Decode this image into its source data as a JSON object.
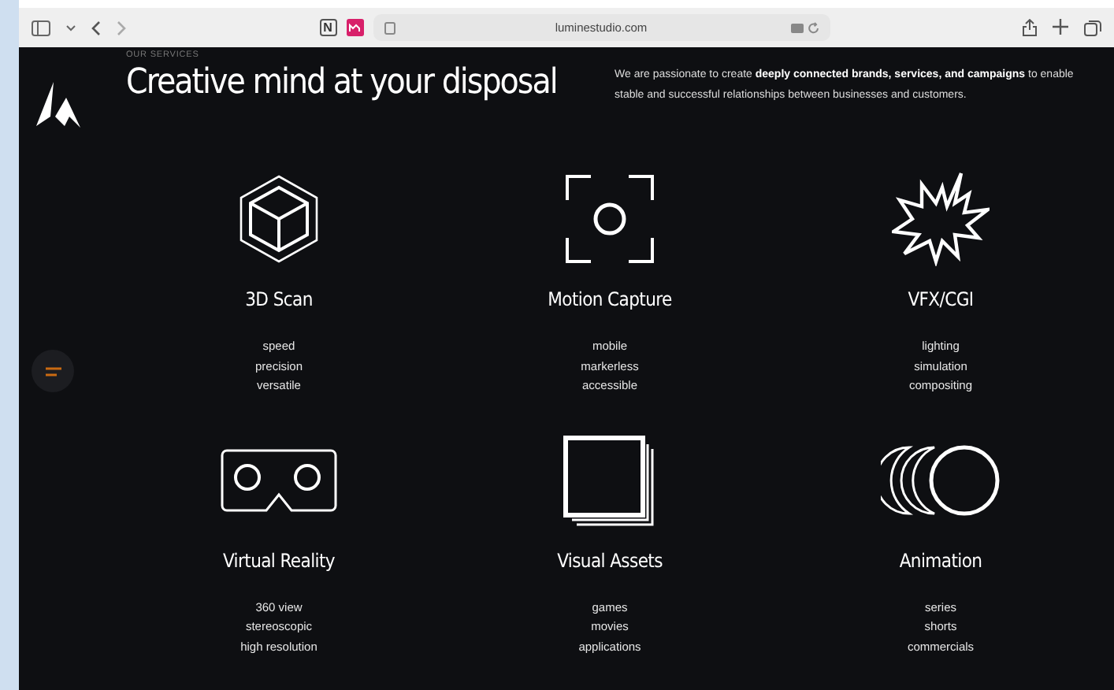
{
  "browser": {
    "tab_favicon_letter": "N",
    "address": "luminestudio.com"
  },
  "header": {
    "eyebrow": "OUR SERVICES",
    "title": "Creative mind at your disposal",
    "intro": "We are passionate to create **deeply connected brands, services, and campaigns** to enable stable and successful relationships between businesses and customers."
  },
  "services": [
    {
      "kind": "cube",
      "title": "3D Scan",
      "features": [
        "speed",
        "precision",
        "versatile"
      ]
    },
    {
      "kind": "capture",
      "title": "Motion Capture",
      "features": [
        "mobile",
        "markerless",
        "accessible"
      ]
    },
    {
      "kind": "burst",
      "title": "VFX/CGI",
      "features": [
        "lighting",
        "simulation",
        "compositing"
      ]
    },
    {
      "kind": "headset",
      "title": "Virtual Reality",
      "features": [
        "360 view",
        "stereoscopic",
        "high resolution"
      ]
    },
    {
      "kind": "stack",
      "title": "Visual Assets",
      "features": [
        "games",
        "movies",
        "applications"
      ]
    },
    {
      "kind": "moons",
      "title": "Animation",
      "features": [
        "series",
        "shorts",
        "commercials"
      ]
    }
  ]
}
